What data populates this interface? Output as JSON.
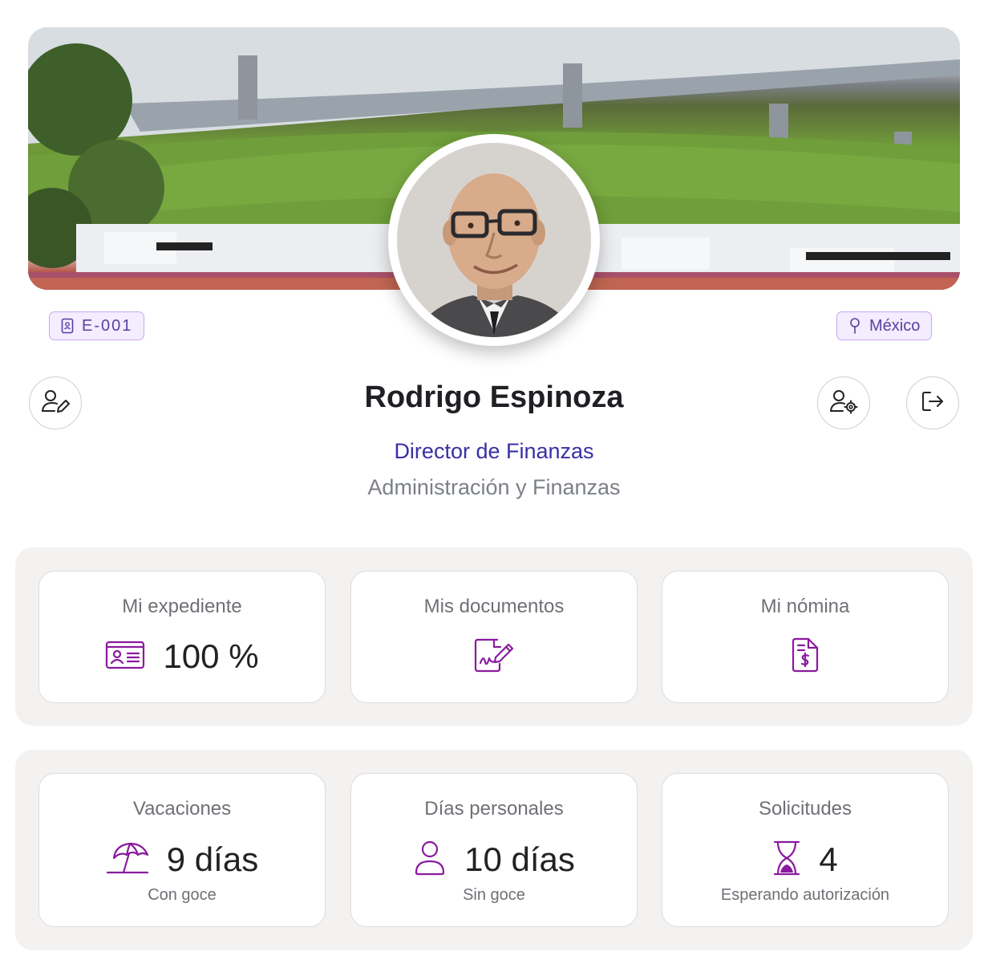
{
  "profile": {
    "employee_id": "E-001",
    "location": "México",
    "name": "Rodrigo Espinoza",
    "role": "Director de Finanzas",
    "department": "Administración y Finanzas"
  },
  "icons": {
    "id": "id-badge-icon",
    "location": "location-pin-icon",
    "edit_profile": "user-edit-icon",
    "user_settings": "user-settings-icon",
    "logout": "logout-icon"
  },
  "cards_top": [
    {
      "title": "Mi expediente",
      "value": "100 %",
      "icon": "id-card-icon"
    },
    {
      "title": "Mis documentos",
      "value": "",
      "icon": "document-signature-icon"
    },
    {
      "title": "Mi nómina",
      "value": "",
      "icon": "invoice-dollar-icon"
    }
  ],
  "cards_bottom": [
    {
      "title": "Vacaciones",
      "value": "9 días",
      "subtitle": "Con goce",
      "icon": "beach-umbrella-icon"
    },
    {
      "title": "Días personales",
      "value": "10 días",
      "subtitle": "Sin goce",
      "icon": "person-icon"
    },
    {
      "title": "Solicitudes",
      "value": "4",
      "subtitle": "Esperando autorización",
      "icon": "hourglass-icon"
    }
  ],
  "colors": {
    "accent": "#8a1a9e",
    "role_text": "#3a2fa6",
    "chip_border": "#c9a8ef",
    "chip_bg": "#f4ecff",
    "panel_bg": "#f3f2f0"
  }
}
